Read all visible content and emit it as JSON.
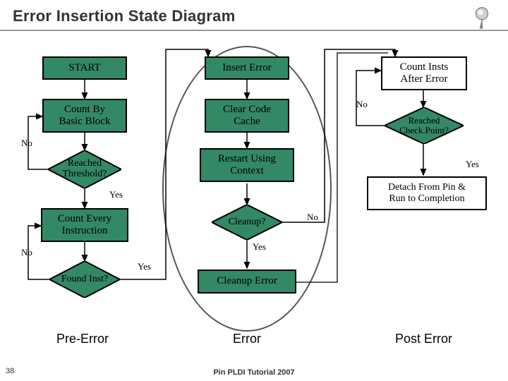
{
  "title": "Error Insertion State Diagram",
  "nodes": {
    "start": "START",
    "count_bb": "Count By\nBasic Block",
    "reached_threshold": "Reached\nThreshold?",
    "count_every": "Count Every\nInstruction",
    "found_inst": "Found Inst?",
    "insert_error": "Insert Error",
    "clear_cache": "Clear Code\nCache",
    "restart_ctx": "Restart Using\nContext",
    "cleanup": "Cleanup?",
    "cleanup_error": "Cleanup Error",
    "count_after": "Count Insts\nAfter Error",
    "reached_cp": "Reached\nCheck.Point?",
    "detach": "Detach From Pin &\nRun to Completion"
  },
  "edge_labels": {
    "no": "No",
    "yes": "Yes"
  },
  "sections": {
    "pre_error": "Pre-Error",
    "error": "Error",
    "post_error": "Post Error"
  },
  "slide_number": "38",
  "footer": "Pin PLDI Tutorial 2007"
}
